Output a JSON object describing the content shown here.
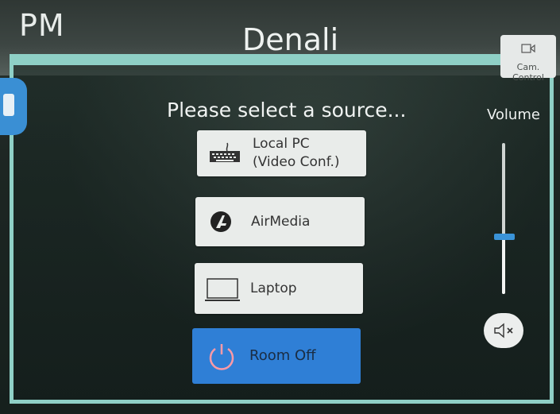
{
  "header": {
    "clock": "PM",
    "room_title": "Denali",
    "cam_control_label": "Cam. Control"
  },
  "main": {
    "prompt": "Please select a source...",
    "sources": [
      {
        "label_line1": "Local PC",
        "label_line2": "(Video Conf.)",
        "icon": "keyboard-icon"
      },
      {
        "label_line1": "AirMedia",
        "icon": "airmedia-logo-icon"
      },
      {
        "label_line1": "Laptop",
        "icon": "laptop-icon"
      }
    ],
    "room_off_label": "Room Off"
  },
  "volume": {
    "label": "Volume",
    "level": 0.38
  },
  "colors": {
    "accent": "#3a93d8",
    "room_off": "#2f7fd6",
    "frame": "#8fd0c6"
  }
}
